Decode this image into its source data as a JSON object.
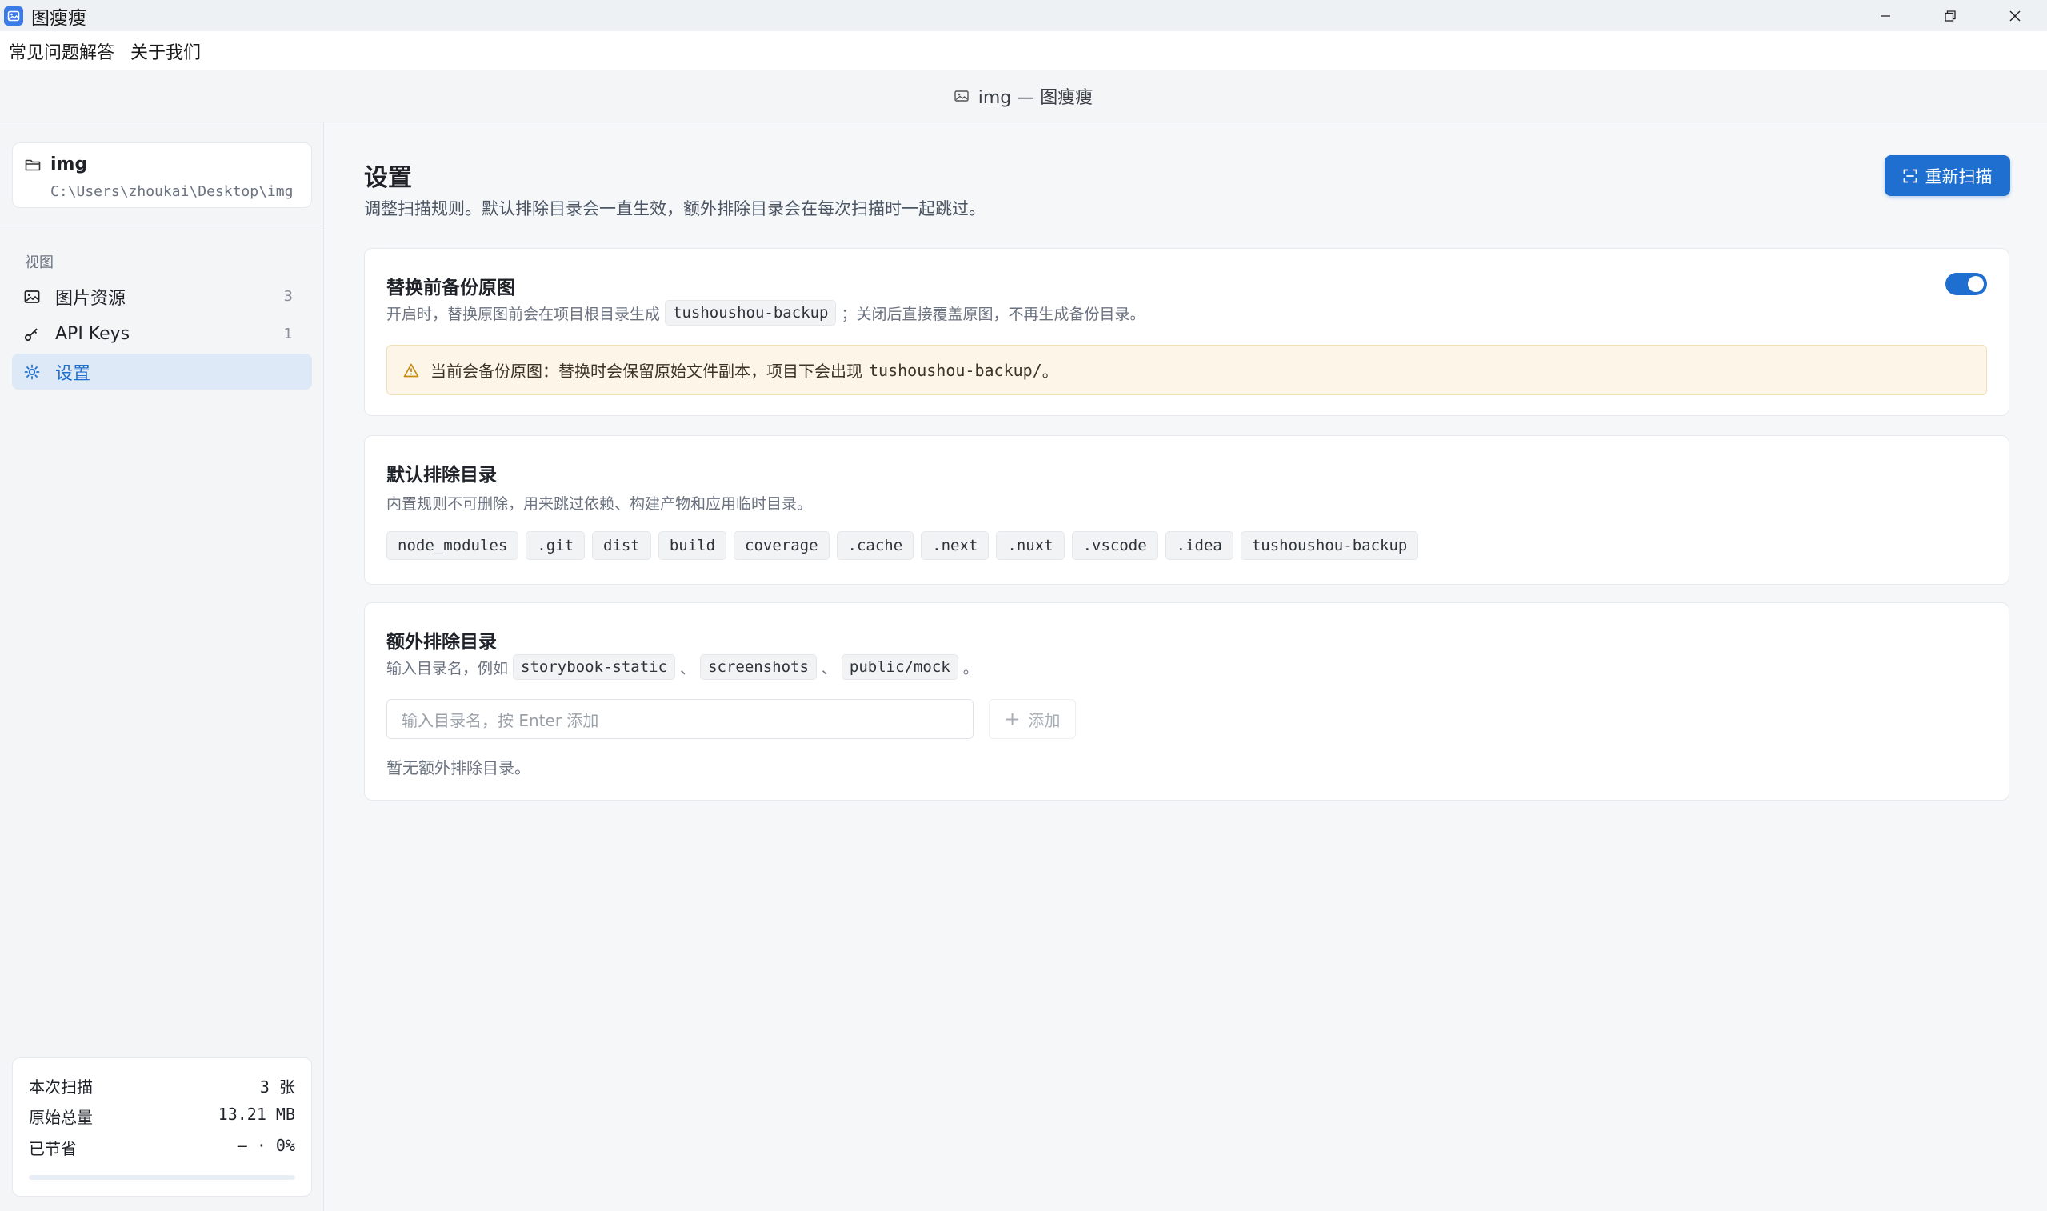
{
  "titlebar": {
    "app_title": "图瘦瘦"
  },
  "menubar": {
    "items": [
      "常见问题解答",
      "关于我们"
    ]
  },
  "header": {
    "title": "img — 图瘦瘦"
  },
  "sidebar": {
    "project": {
      "name": "img",
      "path": "C:\\Users\\zhoukai\\Desktop\\img"
    },
    "section_label": "视图",
    "nav": [
      {
        "label": "图片资源",
        "count": "3"
      },
      {
        "label": "API Keys",
        "count": "1"
      },
      {
        "label": "设置",
        "count": ""
      }
    ],
    "stats": {
      "scan_label": "本次扫描",
      "scan_value": "3 张",
      "total_label": "原始总量",
      "total_value": "13.21 MB",
      "saved_label": "已节省",
      "saved_value": "— · 0%",
      "progress": 0
    }
  },
  "main": {
    "title": "设置",
    "desc": "调整扫描规则。默认排除目录会一直生效，额外排除目录会在每次扫描时一起跳过。",
    "rescan_label": "重新扫描",
    "backup": {
      "title": "替换前备份原图",
      "desc_before": "开启时，替换原图前会在项目根目录生成",
      "desc_chip": "tushoushou-backup",
      "desc_after": "；关闭后直接覆盖原图，不再生成备份目录。",
      "enabled": true,
      "warning_text": "当前会备份原图：替换时会保留原始文件副本，项目下会出现",
      "warning_path": "tushoushou-backup/",
      "warning_end": "。"
    },
    "default_excludes": {
      "title": "默认排除目录",
      "desc": "内置规则不可删除，用来跳过依赖、构建产物和应用临时目录。",
      "dirs": [
        "node_modules",
        ".git",
        "dist",
        "build",
        "coverage",
        ".cache",
        ".next",
        ".nuxt",
        ".vscode",
        ".idea",
        "tushoushou-backup"
      ]
    },
    "extra_excludes": {
      "title": "额外排除目录",
      "desc_prefix": "输入目录名，例如",
      "examples": [
        "storybook-static",
        "screenshots",
        "public/mock"
      ],
      "sep": "、",
      "desc_end": "。",
      "input_placeholder": "输入目录名，按 Enter 添加",
      "add_label": "添加",
      "empty_text": "暂无额外排除目录。"
    }
  },
  "colors": {
    "accent": "#1e6fd0",
    "warning_bg": "#fdf6e8"
  }
}
